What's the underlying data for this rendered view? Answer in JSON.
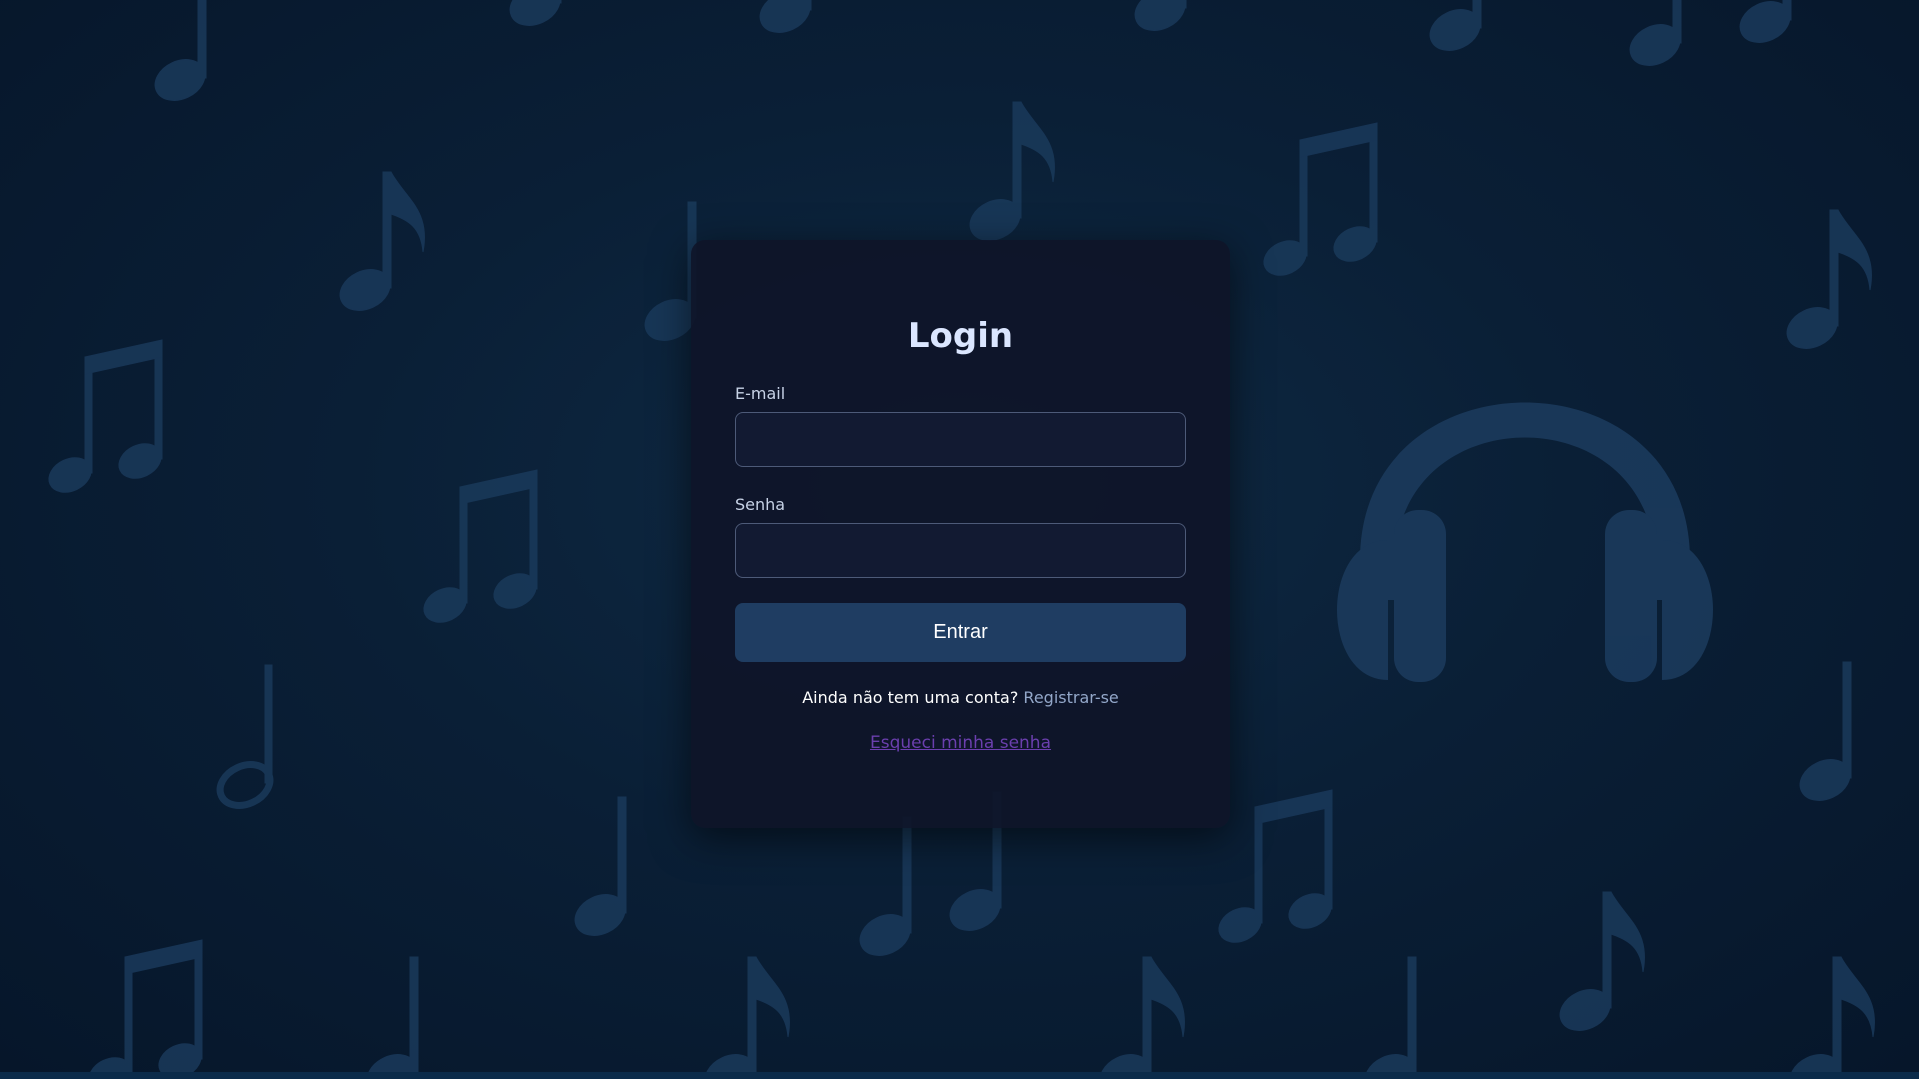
{
  "login": {
    "title": "Login",
    "email_label": "E-mail",
    "email_value": "",
    "password_label": "Senha",
    "password_value": "",
    "submit_label": "Entrar",
    "register_prompt": "Ainda não tem uma conta?",
    "register_link": "Registrar-se",
    "forgot_link": "Esqueci minha senha"
  },
  "colors": {
    "background": "#0a1f36",
    "card": "#0e1428",
    "button": "#1f3d62",
    "register_link": "#93a7c9",
    "forgot_link": "#6b3fae",
    "decoration": "#1b3a5c"
  },
  "background_icons": [
    "music-note-icon",
    "beamed-notes-icon",
    "headphones-icon"
  ]
}
